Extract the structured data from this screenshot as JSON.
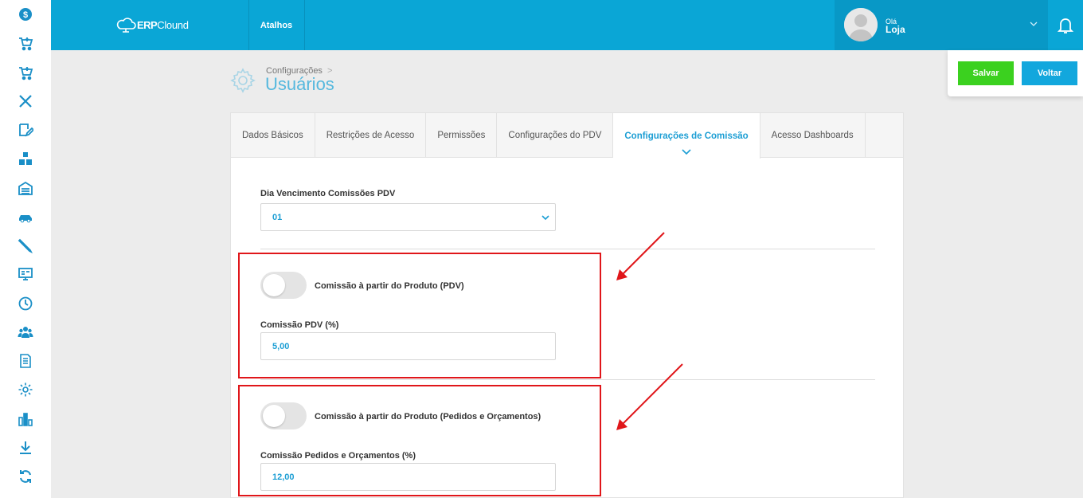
{
  "topbar": {
    "logo_bold": "ERP",
    "logo_text": "Clound",
    "shortcuts_label": "Atalhos",
    "greeting": "Olá",
    "username": "Loja",
    "accent_color": "#0aa6d6"
  },
  "sidebar": {
    "items": [
      {
        "icon": "dollar-icon"
      },
      {
        "icon": "cart-add-icon"
      },
      {
        "icon": "cart-add-icon"
      },
      {
        "icon": "tools-icon"
      },
      {
        "icon": "edit-note-icon"
      },
      {
        "icon": "boxes-icon"
      },
      {
        "icon": "warehouse-icon"
      },
      {
        "icon": "car-icon"
      },
      {
        "icon": "pencil-icon"
      },
      {
        "icon": "monitor-icon"
      },
      {
        "icon": "clock-icon"
      },
      {
        "icon": "users-icon"
      },
      {
        "icon": "document-icon"
      },
      {
        "icon": "gear-icon"
      },
      {
        "icon": "bar-chart-icon"
      },
      {
        "icon": "download-icon"
      },
      {
        "icon": "sync-icon"
      }
    ]
  },
  "actions": {
    "save_label": "Salvar",
    "back_label": "Voltar"
  },
  "header": {
    "breadcrumb": "Configurações",
    "breadcrumb_separator": ">",
    "title": "Usuários"
  },
  "tabs": [
    {
      "label": "Dados Básicos"
    },
    {
      "label": "Restrições de Acesso"
    },
    {
      "label": "Permissões"
    },
    {
      "label": "Configurações do PDV"
    },
    {
      "label": "Configurações de Comissão",
      "active": true
    },
    {
      "label": "Acesso Dashboards"
    }
  ],
  "form": {
    "due_day_label": "Dia Vencimento Comissões PDV",
    "due_day_value": "01",
    "pdv_toggle_label": "Comissão à partir do Produto (PDV)",
    "pdv_toggle_on": false,
    "pdv_commission_label": "Comissão PDV (%)",
    "pdv_commission_value": "5,00",
    "orders_toggle_label": "Comissão à partir do Produto (Pedidos e Orçamentos)",
    "orders_toggle_on": false,
    "orders_commission_label": "Comissão Pedidos e Orçamentos (%)",
    "orders_commission_value": "12,00"
  },
  "annotation": {
    "highlight_color": "#e0161a"
  }
}
